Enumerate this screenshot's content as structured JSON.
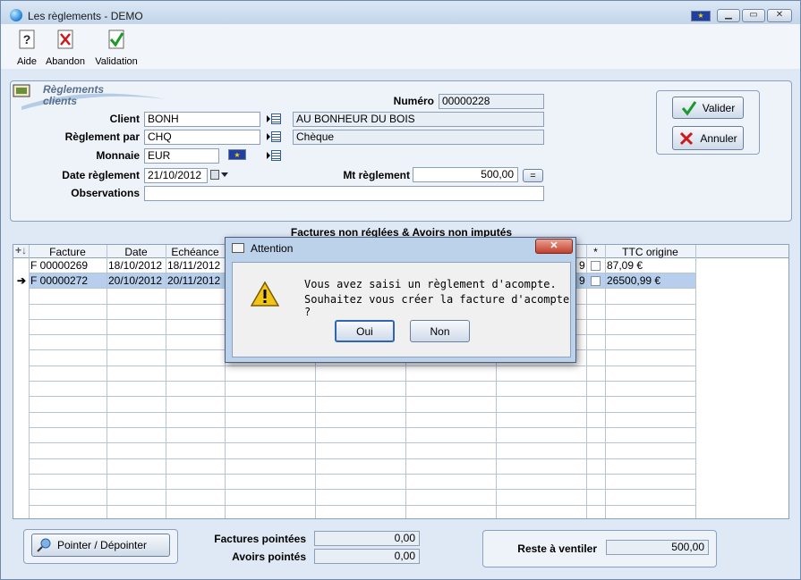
{
  "window": {
    "title": "Les règlements - DEMO"
  },
  "toolbar": {
    "aide": "Aide",
    "abandon": "Abandon",
    "validation": "Validation"
  },
  "logo": {
    "line1": "Règlements",
    "line2": "clients"
  },
  "form": {
    "numero_label": "Numéro",
    "numero": "00000228",
    "client_label": "Client",
    "client_code": "BONH",
    "client_name": "AU BONHEUR DU BOIS",
    "reglement_par_label": "Règlement par",
    "reglement_code": "CHQ",
    "reglement_name": "Chèque",
    "monnaie_label": "Monnaie",
    "monnaie": "EUR",
    "date_label": "Date règlement",
    "date": "21/10/2012",
    "mt_label": "Mt règlement",
    "mt": "500,00",
    "eq_label": "=",
    "observations_label": "Observations",
    "observations": ""
  },
  "actions": {
    "valider": "Valider",
    "annuler": "Annuler"
  },
  "grid": {
    "title": "Factures non réglées & Avoirs non imputés",
    "headers": {
      "facture": "Facture",
      "date": "Date",
      "echeance": "Echéance",
      "star": "*",
      "ttc": "TTC origine"
    },
    "rows": [
      {
        "facture": "F 00000269",
        "date": "18/10/2012",
        "echeance": "18/11/2012",
        "clip": "9",
        "ttc": "87,09 €"
      },
      {
        "facture": "F 00000272",
        "date": "20/10/2012",
        "echeance": "20/11/2012",
        "clip": "9",
        "ttc": "26500,99 €"
      }
    ]
  },
  "footer": {
    "pointer_label": "Pointer / Dépointer",
    "factures_pointees_label": "Factures pointées",
    "factures_pointees": "0,00",
    "avoirs_pointes_label": "Avoirs pointés",
    "avoirs_pointes": "0,00",
    "reste_label": "Reste à ventiler",
    "reste": "500,00"
  },
  "dialog": {
    "title": "Attention",
    "line1": "Vous avez saisi un règlement d'acompte.",
    "line2": "Souhaitez vous créer la facture d'acompte ?",
    "oui": "Oui",
    "non": "Non"
  }
}
